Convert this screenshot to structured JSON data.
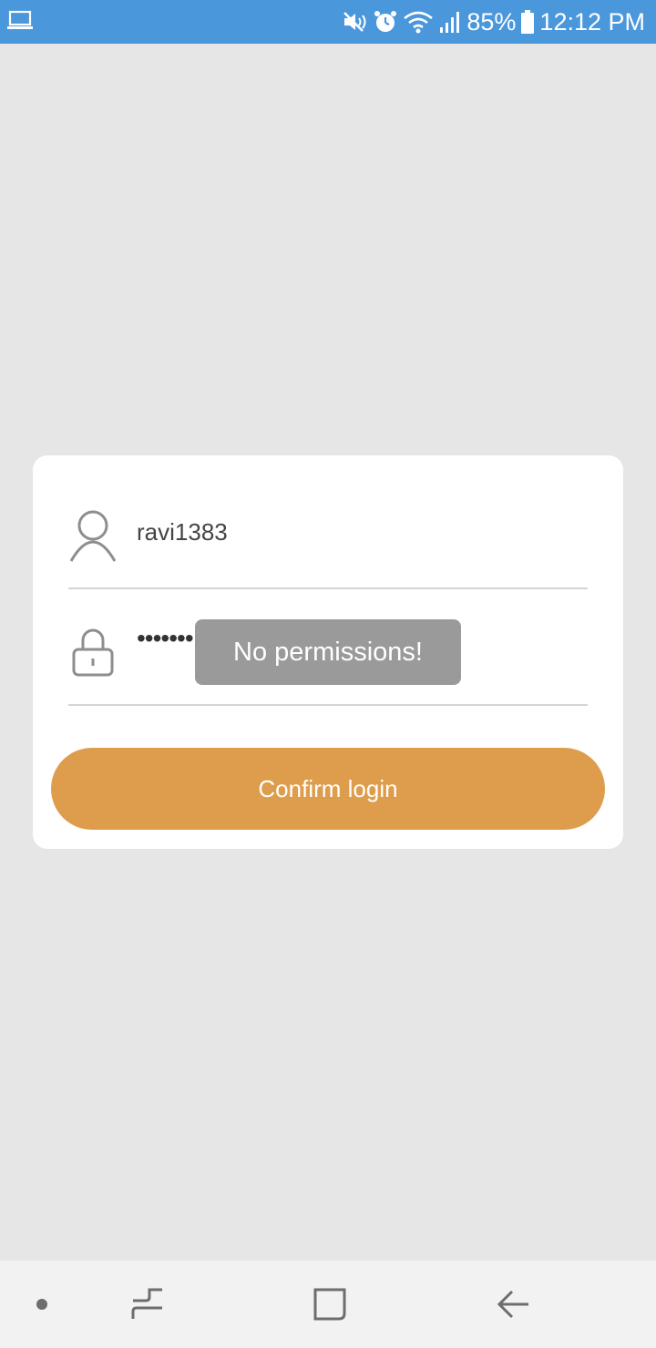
{
  "status_bar": {
    "left_icon": "laptop-icon",
    "icons": [
      "mute-icon",
      "alarm-icon",
      "wifi-icon",
      "signal-icon"
    ],
    "battery": "85%",
    "battery_icon": "battery-icon",
    "time": "12:12 PM",
    "color": "#4a97dc"
  },
  "login": {
    "username_icon": "user-icon",
    "username": "ravi1383",
    "password_icon": "lock-icon",
    "password_masked": "•••••••",
    "confirm_label": "Confirm login",
    "confirm_color": "#dd9d4c"
  },
  "toast": {
    "message": "No permissions!"
  },
  "nav_bar": {
    "items": [
      "dot-icon",
      "recent-apps-icon",
      "home-icon",
      "back-icon"
    ]
  }
}
